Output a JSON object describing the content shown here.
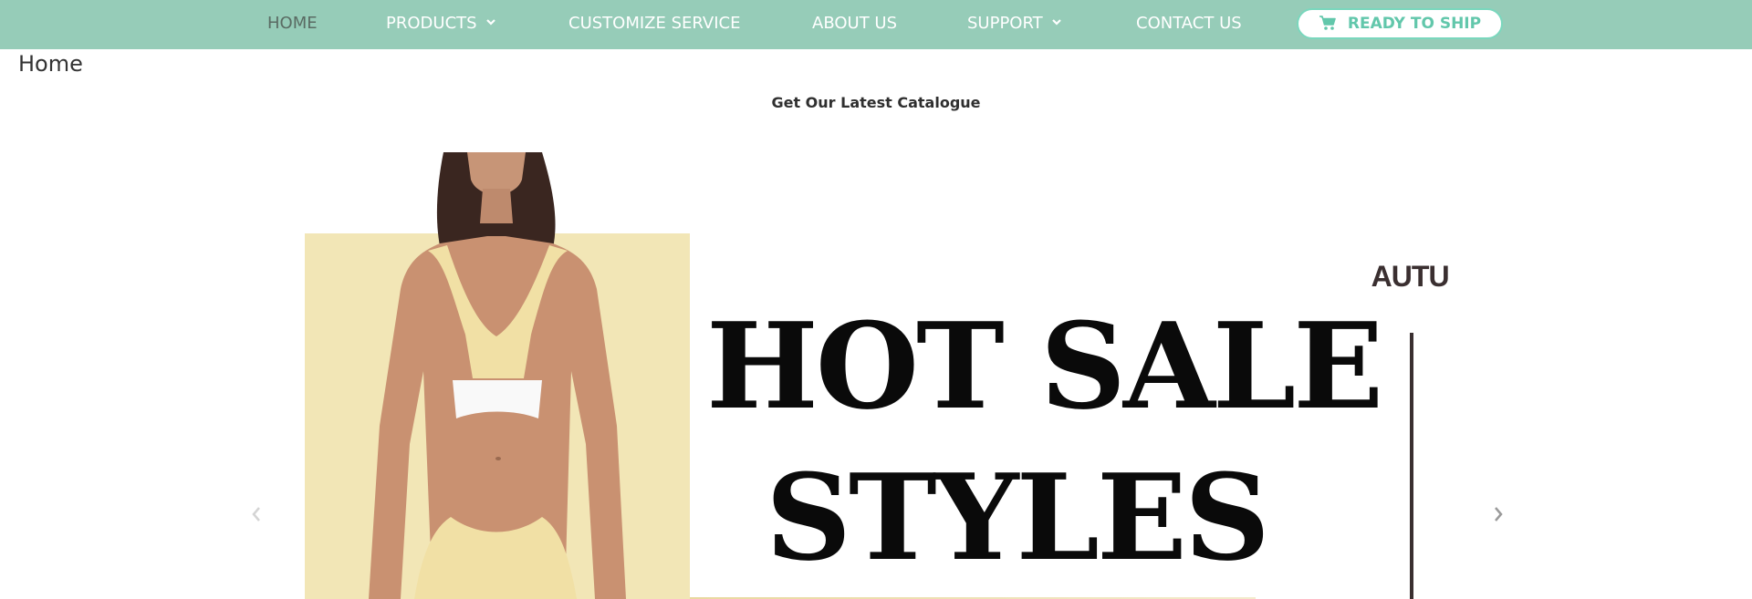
{
  "nav": {
    "items": [
      {
        "label": "HOME",
        "active": true
      },
      {
        "label": "PRODUCTS",
        "has_dropdown": true
      },
      {
        "label": "CUSTOMIZE SERVICE"
      },
      {
        "label": "ABOUT US"
      },
      {
        "label": "SUPPORT",
        "has_dropdown": true
      },
      {
        "label": "CONTACT US"
      }
    ],
    "cta": {
      "label": "READY TO SHIP",
      "icon": "cart-icon"
    }
  },
  "breadcrumb": "Home",
  "catalogue_link": "Get Our Latest Catalogue",
  "banner": {
    "season": "AUTUMN",
    "headline_line1": "HOT SALE",
    "headline_line2": "STYLES",
    "prev_icon": "chevron-left-icon",
    "next_icon": "chevron-right-icon"
  },
  "colors": {
    "nav_bg": "#96ccb8",
    "nav_text": "#ffffff",
    "nav_active_text": "#5a6b63",
    "cta_accent": "#62c7ab",
    "banner_yellow": "#f2e6b6",
    "headline": "#0a0a0a",
    "season_text": "#3a2f30"
  }
}
